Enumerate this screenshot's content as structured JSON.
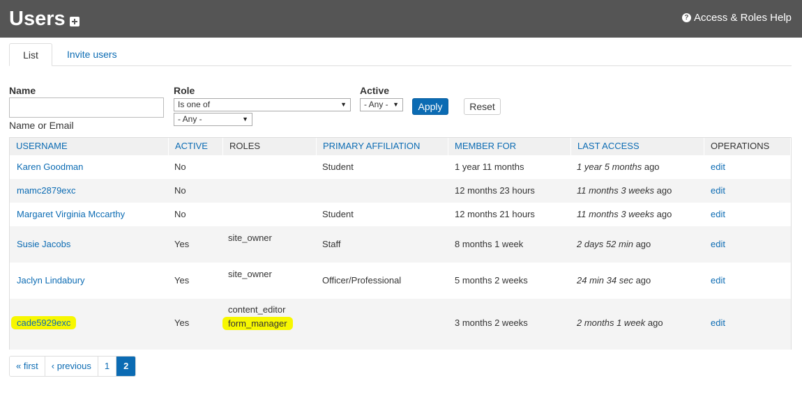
{
  "header": {
    "title": "Users",
    "add_icon": "plus-square-icon",
    "help_link": "Access & Roles Help",
    "help_icon": "question-circle-icon"
  },
  "tabs": [
    {
      "label": "List",
      "active": true
    },
    {
      "label": "Invite users",
      "active": false
    }
  ],
  "filters": {
    "name_label": "Name",
    "name_value": "",
    "name_description": "Name or Email",
    "role_label": "Role",
    "role_operator": "Is one of",
    "role_value": "- Any -",
    "active_label": "Active",
    "active_value": "- Any -",
    "apply_label": "Apply",
    "reset_label": "Reset"
  },
  "table": {
    "columns": [
      "USERNAME",
      "ACTIVE",
      "ROLES",
      "PRIMARY AFFILIATION",
      "MEMBER FOR",
      "LAST ACCESS",
      "OPERATIONS"
    ],
    "rows": [
      {
        "username": "Karen Goodman",
        "active": "No",
        "roles": [],
        "affiliation": "Student",
        "member_for": "1 year 11 months",
        "last_access": "1 year 5 months",
        "ago": "ago",
        "operation": "edit"
      },
      {
        "username": "mamc2879exc",
        "active": "No",
        "roles": [],
        "affiliation": "",
        "member_for": "12 months 23 hours",
        "last_access": "11 months 3 weeks",
        "ago": "ago",
        "operation": "edit"
      },
      {
        "username": "Margaret Virginia Mccarthy",
        "active": "No",
        "roles": [],
        "affiliation": "Student",
        "member_for": "12 months 21 hours",
        "last_access": "11 months 3 weeks",
        "ago": "ago",
        "operation": "edit"
      },
      {
        "username": "Susie Jacobs",
        "active": "Yes",
        "roles": [
          "site_owner"
        ],
        "affiliation": "Staff",
        "member_for": "8 months 1 week",
        "last_access": "2 days 52 min",
        "ago": "ago",
        "operation": "edit"
      },
      {
        "username": "Jaclyn Lindabury",
        "active": "Yes",
        "roles": [
          "site_owner"
        ],
        "affiliation": "Officer/Professional",
        "member_for": "5 months 2 weeks",
        "last_access": "24 min 34 sec",
        "ago": "ago",
        "operation": "edit"
      },
      {
        "username": "cade5929exc",
        "active": "Yes",
        "roles": [
          "content_editor",
          "form_manager"
        ],
        "affiliation": "",
        "member_for": "3 months 2 weeks",
        "last_access": "2 months 1 week",
        "ago": "ago",
        "operation": "edit"
      }
    ]
  },
  "pager": {
    "first": "« first",
    "previous": "‹ previous",
    "pages": [
      "1",
      "2"
    ],
    "current": "2"
  },
  "colors": {
    "header_bg": "#555555",
    "link": "#0b6bb3",
    "highlight": "#f7f700"
  }
}
